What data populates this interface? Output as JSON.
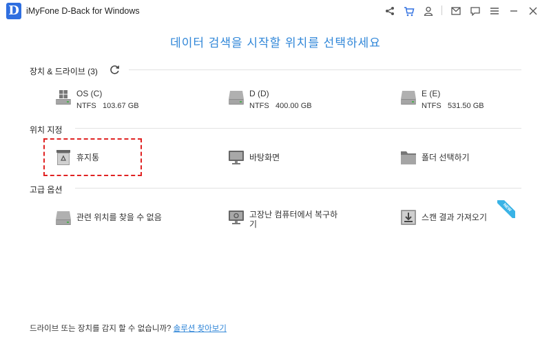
{
  "app": {
    "logo_letter": "D",
    "title": "iMyFone D-Back for Windows"
  },
  "titlebar_icons": [
    "share-icon",
    "cart-icon",
    "user-icon",
    "mail-icon",
    "feedback-icon",
    "minimize-icon",
    "close-icon"
  ],
  "headline": "데이터 검색을 시작할 위치를 선택하세요",
  "sections": {
    "devices": {
      "title": "장치 & 드라이브 (3)"
    },
    "location": {
      "title": "위치 지정"
    },
    "advanced": {
      "title": "고급 옵션"
    }
  },
  "drives": [
    {
      "name": "OS (C)",
      "fs": "NTFS",
      "size": "103.67 GB"
    },
    {
      "name": "D (D)",
      "fs": "NTFS",
      "size": "400.00 GB"
    },
    {
      "name": "E (E)",
      "fs": "NTFS",
      "size": "531.50 GB"
    }
  ],
  "locations": [
    {
      "label": "휴지통"
    },
    {
      "label": "바탕화면"
    },
    {
      "label": "폴더 선택하기"
    }
  ],
  "advanced": [
    {
      "label": "관련 위치를 찾을 수 없음"
    },
    {
      "label": "고장난 컴퓨터에서 복구하기"
    },
    {
      "label": "스캔 결과 가져오기"
    }
  ],
  "badge": "NEW",
  "footer": {
    "text": "드라이브 또는 장치를 감지 할 수 없습니까?",
    "link": "솔루션 찾아보기"
  },
  "colors": {
    "accent": "#2f86d8",
    "logo": "#2f6fe0",
    "highlight": "#e02020",
    "badge": "#39b3e6"
  }
}
